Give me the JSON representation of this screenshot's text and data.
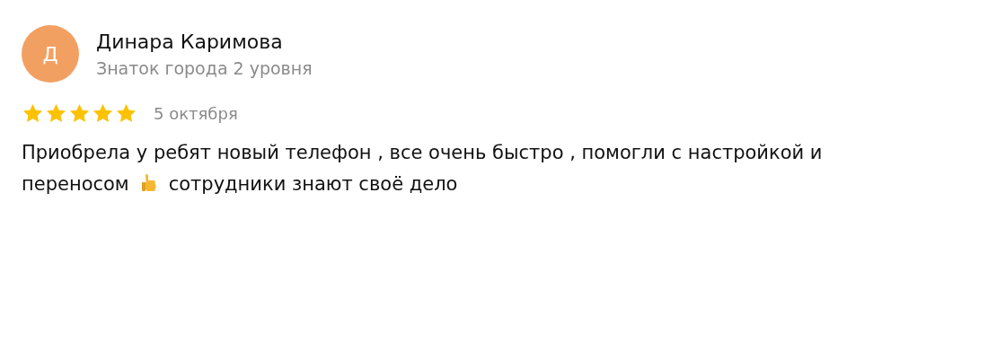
{
  "author": {
    "initial": "Д",
    "name": "Динара Каримова",
    "level": "Знаток города 2 уровня"
  },
  "review": {
    "stars": 5,
    "date": "5 октября",
    "text_before": "Приобрела у ребят новый телефон , все очень быстро , помогли с настройкой и переносом",
    "text_after": "сотрудники знают своё дело"
  }
}
